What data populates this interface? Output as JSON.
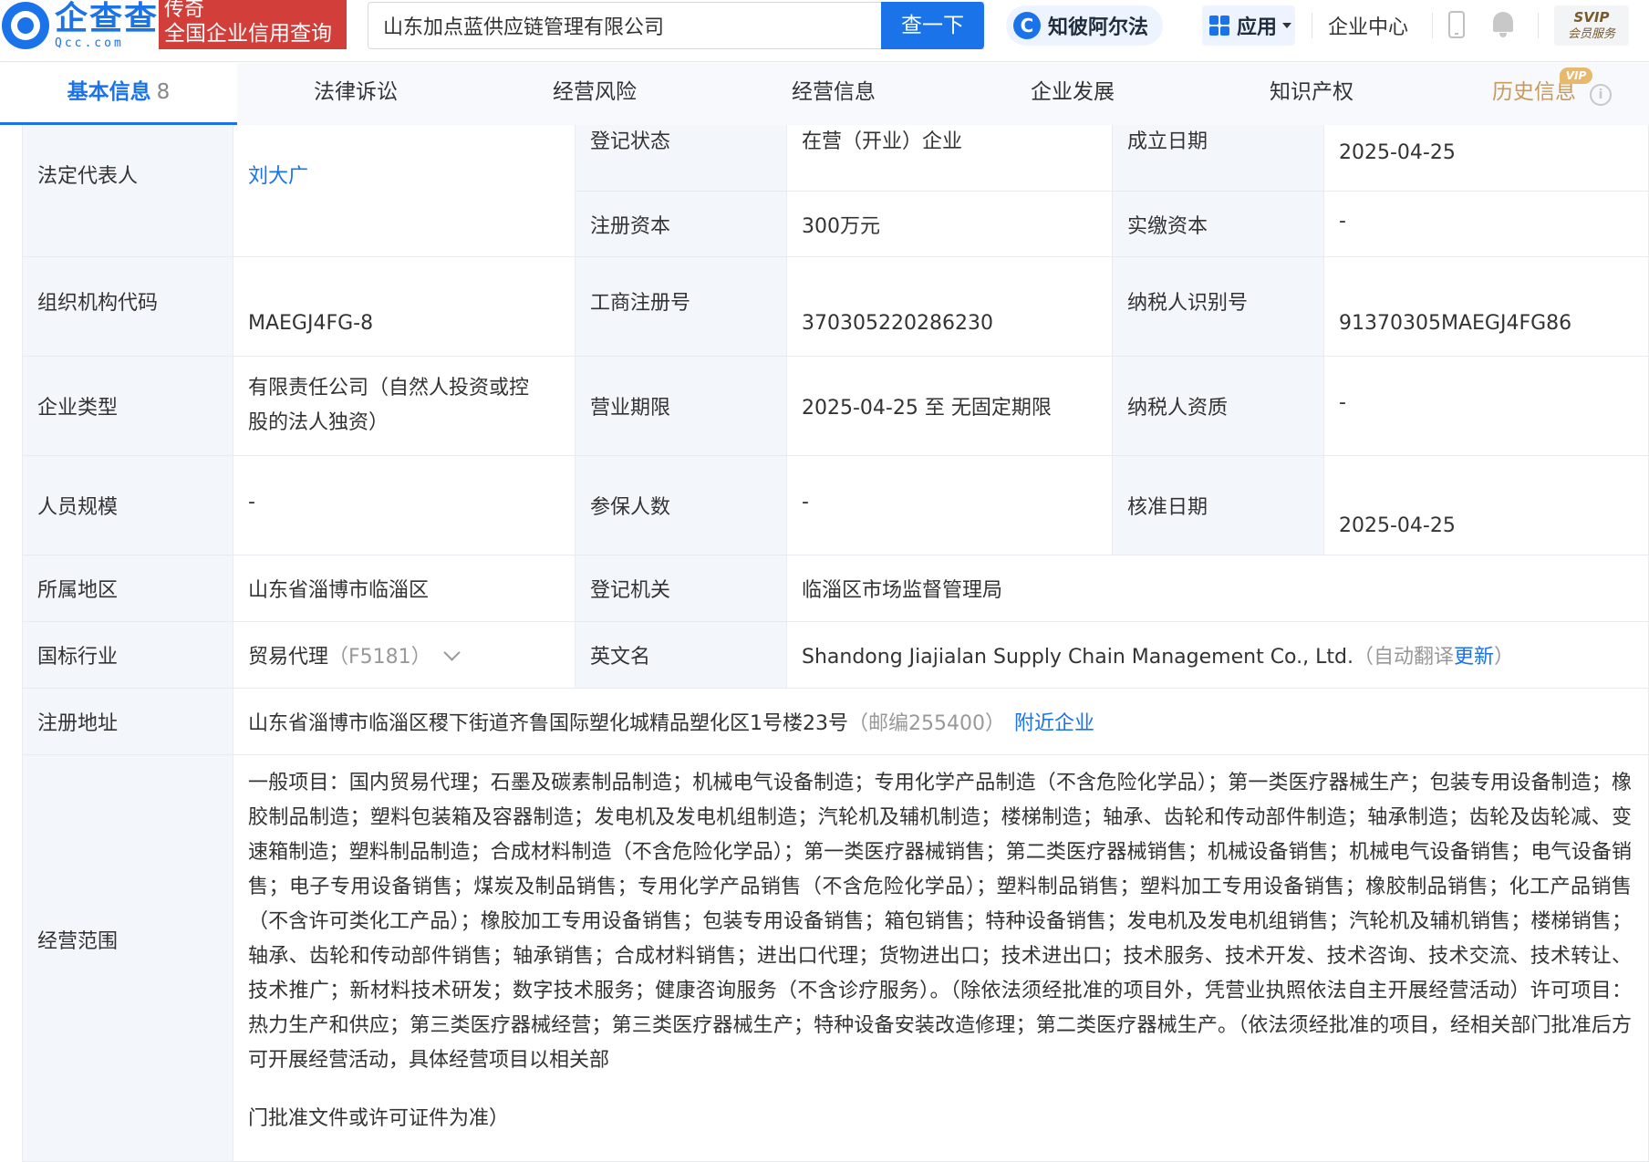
{
  "header": {
    "logo_cn": "企查查",
    "logo_en": "Qcc.com",
    "logo_tag_line1": "传奇",
    "logo_tag_line2": "全国企业信用查询",
    "search_value": "山东加点蓝供应链管理有限公司",
    "search_button": "查一下",
    "ai_label": "知彼阿尔法",
    "apps_label": "应用",
    "enterprise_center": "企业中心",
    "svip_top": "SVIP",
    "svip_bottom": "会员服务"
  },
  "tabs": [
    {
      "label": "基本信息",
      "count": "8"
    },
    {
      "label": "法律诉讼"
    },
    {
      "label": "经营风险"
    },
    {
      "label": "经营信息"
    },
    {
      "label": "企业发展"
    },
    {
      "label": "知识产权"
    },
    {
      "label": "历史信息",
      "badge": "VIP"
    }
  ],
  "info": {
    "legal_rep_label": "法定代表人",
    "legal_rep": "刘大广",
    "reg_status_label": "登记状态",
    "reg_status": "在营（开业）企业",
    "found_date_label": "成立日期",
    "found_date": "2025-04-25",
    "reg_capital_label": "注册资本",
    "reg_capital": "300万元",
    "paid_capital_label": "实缴资本",
    "paid_capital": "-",
    "org_code_label": "组织机构代码",
    "org_code": "MAEGJ4FG-8",
    "biz_reg_no_label": "工商注册号",
    "biz_reg_no": "370305220286230",
    "taxpayer_id_label": "纳税人识别号",
    "taxpayer_id": "91370305MAEGJ4FG86",
    "company_type_label": "企业类型",
    "company_type_line1": "有限责任公司（自然人投资或控",
    "company_type_line2": "股的法人独资）",
    "biz_term_label": "营业期限",
    "biz_term": "2025-04-25 至 无固定期限",
    "taxpayer_qual_label": "纳税人资质",
    "taxpayer_qual": "-",
    "staff_size_label": "人员规模",
    "staff_size": "-",
    "insured_label": "参保人数",
    "insured": "-",
    "approve_date_label": "核准日期",
    "approve_date": "2025-04-25",
    "region_label": "所属地区",
    "region": "山东省淄博市临淄区",
    "reg_authority_label": "登记机关",
    "reg_authority": "临淄区市场监督管理局",
    "industry_label": "国标行业",
    "industry": "贸易代理",
    "industry_code": "（F5181）",
    "english_name_label": "英文名",
    "english_name": "Shandong Jiajialan Supply Chain Management Co., Ltd.",
    "translate_note_pre": "（自动翻译",
    "translate_update": "更新",
    "translate_note_post": "）",
    "address_label": "注册地址",
    "address": "山东省淄博市临淄区稷下街道齐鲁国际塑化城精品塑化区1号楼23号",
    "postcode": "（邮编255400）",
    "nearby": "附近企业",
    "scope_label": "经营范围",
    "scope": "一般项目：国内贸易代理；石墨及碳素制品制造；机械电气设备制造；专用化学产品制造（不含危险化学品）；第一类医疗器械生产；包装专用设备制造；橡胶制品制造；塑料包装箱及容器制造；发电机及发电机组制造；汽轮机及辅机制造；楼梯制造；轴承、齿轮和传动部件制造；轴承制造；齿轮及齿轮减、变速箱制造；塑料制品制造；合成材料制造（不含危险化学品）；第一类医疗器械销售；第二类医疗器械销售；机械设备销售；机械电气设备销售；电气设备销售；电子专用设备销售；煤炭及制品销售；专用化学产品销售（不含危险化学品）；塑料制品销售；塑料加工专用设备销售；橡胶制品销售；化工产品销售（不含许可类化工产品）；橡胶加工专用设备销售；包装专用设备销售；箱包销售；特种设备销售；发电机及发电机组销售；汽轮机及辅机销售；楼梯销售；轴承、齿轮和传动部件销售；轴承销售；合成材料销售；进出口代理；货物进出口；技术进出口；技术服务、技术开发、技术咨询、技术交流、技术转让、技术推广；新材料技术研发；数字技术服务；健康咨询服务（不含诊疗服务）。（除依法须经批准的项目外，凭营业执照依法自主开展经营活动）许可项目：热力生产和供应；第三类医疗器械经营；第三类医疗器械生产；特种设备安装改造修理；第二类医疗器械生产。（依法须经批准的项目，经相关部门批准后方可开展经营活动，具体经营项目以相关部",
    "scope_tail": "门批准文件或许可证件为准）"
  }
}
